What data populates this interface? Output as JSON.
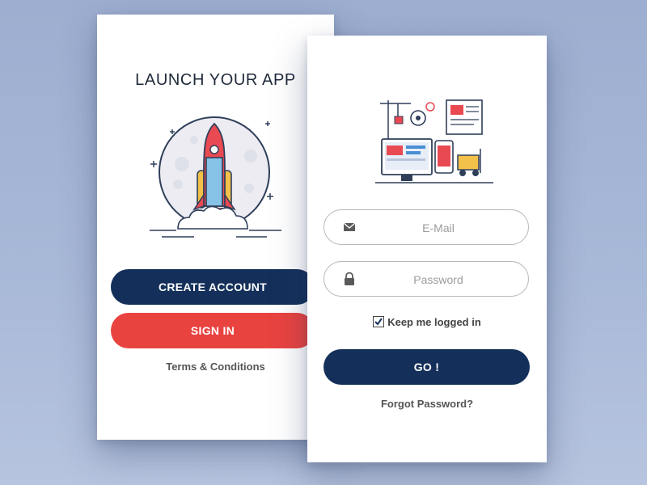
{
  "left_card": {
    "title": "LAUNCH YOUR APP",
    "create_account_label": "CREATE ACCOUNT",
    "sign_in_label": "SIGN IN",
    "terms_label": "Terms & Conditions"
  },
  "right_card": {
    "email_placeholder": "E-Mail",
    "password_placeholder": "Password",
    "keep_logged_in_label": "Keep me logged in",
    "keep_logged_in_checked": true,
    "go_label": "GO !",
    "forgot_label": "Forgot Password?"
  },
  "icons": {
    "hero_left": "rocket-illustration",
    "hero_right": "app-development-tools-illustration",
    "email": "envelope-icon",
    "password": "lock-icon",
    "checkbox": "checkmark-icon"
  },
  "colors": {
    "primary_navy": "#14305a",
    "accent_red": "#e94340",
    "background": "#a9b9d8"
  }
}
